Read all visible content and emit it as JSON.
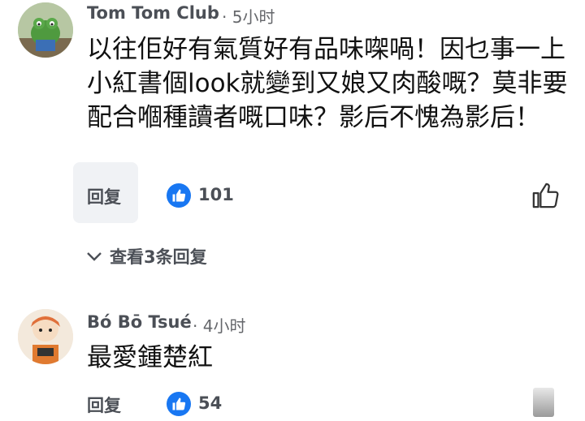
{
  "comments": [
    {
      "author": "Tom Tom Club",
      "time": "· 5小时",
      "text": "以往佢好有氣質好有品味㗎喎！因乜事一上小紅書個look就變到又娘又肉酸嘅？莫非要配合嗰種讀者嘅口味？影后不愧為影后！",
      "reply_label": "回复",
      "likes": "101",
      "view_replies_label": "查看3条回复",
      "avatar_icon": "frog-avatar-icon"
    },
    {
      "author": "Bó Bō Tsué",
      "time": "· 4小时",
      "text": "最愛鍾楚紅",
      "reply_label": "回复",
      "likes": "54",
      "avatar_icon": "doll-avatar-icon"
    }
  ],
  "colors": {
    "like_blue": "#1877f2",
    "meta_gray": "#65676b"
  }
}
